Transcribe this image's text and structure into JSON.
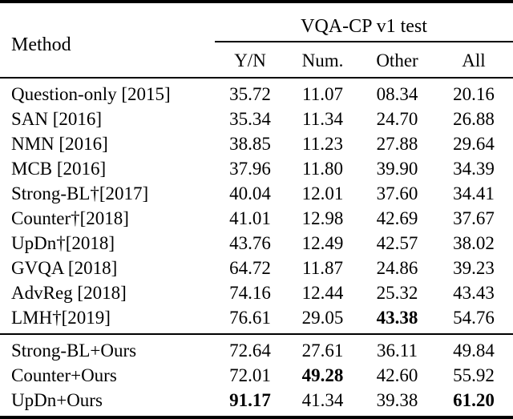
{
  "table": {
    "method_header": "Method",
    "group_header": "VQA-CP v1 test",
    "columns": [
      "Y/N",
      "Num.",
      "Other",
      "All"
    ],
    "sections": [
      {
        "rows": [
          {
            "method": "Question-only [2015]",
            "values": [
              "35.72",
              "11.07",
              "08.34",
              "20.16"
            ],
            "bold": [
              false,
              false,
              false,
              false
            ]
          },
          {
            "method": "SAN [2016]",
            "values": [
              "35.34",
              "11.34",
              "24.70",
              "26.88"
            ],
            "bold": [
              false,
              false,
              false,
              false
            ]
          },
          {
            "method": "NMN [2016]",
            "values": [
              "38.85",
              "11.23",
              "27.88",
              "29.64"
            ],
            "bold": [
              false,
              false,
              false,
              false
            ]
          },
          {
            "method": "MCB [2016]",
            "values": [
              "37.96",
              "11.80",
              "39.90",
              "34.39"
            ],
            "bold": [
              false,
              false,
              false,
              false
            ]
          },
          {
            "method": "Strong-BL†[2017]",
            "values": [
              "40.04",
              "12.01",
              "37.60",
              "34.41"
            ],
            "bold": [
              false,
              false,
              false,
              false
            ]
          },
          {
            "method": "Counter†[2018]",
            "values": [
              "41.01",
              "12.98",
              "42.69",
              "37.67"
            ],
            "bold": [
              false,
              false,
              false,
              false
            ]
          },
          {
            "method": "UpDn†[2018]",
            "values": [
              "43.76",
              "12.49",
              "42.57",
              "38.02"
            ],
            "bold": [
              false,
              false,
              false,
              false
            ]
          },
          {
            "method": "GVQA [2018]",
            "values": [
              "64.72",
              "11.87",
              "24.86",
              "39.23"
            ],
            "bold": [
              false,
              false,
              false,
              false
            ]
          },
          {
            "method": "AdvReg [2018]",
            "values": [
              "74.16",
              "12.44",
              "25.32",
              "43.43"
            ],
            "bold": [
              false,
              false,
              false,
              false
            ]
          },
          {
            "method": "LMH†[2019]",
            "values": [
              "76.61",
              "29.05",
              "43.38",
              "54.76"
            ],
            "bold": [
              false,
              false,
              true,
              false
            ]
          }
        ]
      },
      {
        "rows": [
          {
            "method": "Strong-BL+Ours",
            "values": [
              "72.64",
              "27.61",
              "36.11",
              "49.84"
            ],
            "bold": [
              false,
              false,
              false,
              false
            ]
          },
          {
            "method": "Counter+Ours",
            "values": [
              "72.01",
              "49.28",
              "42.60",
              "55.92"
            ],
            "bold": [
              false,
              true,
              false,
              false
            ]
          },
          {
            "method": "UpDn+Ours",
            "values": [
              "91.17",
              "41.34",
              "39.38",
              "61.20"
            ],
            "bold": [
              true,
              false,
              false,
              true
            ]
          }
        ]
      }
    ]
  }
}
